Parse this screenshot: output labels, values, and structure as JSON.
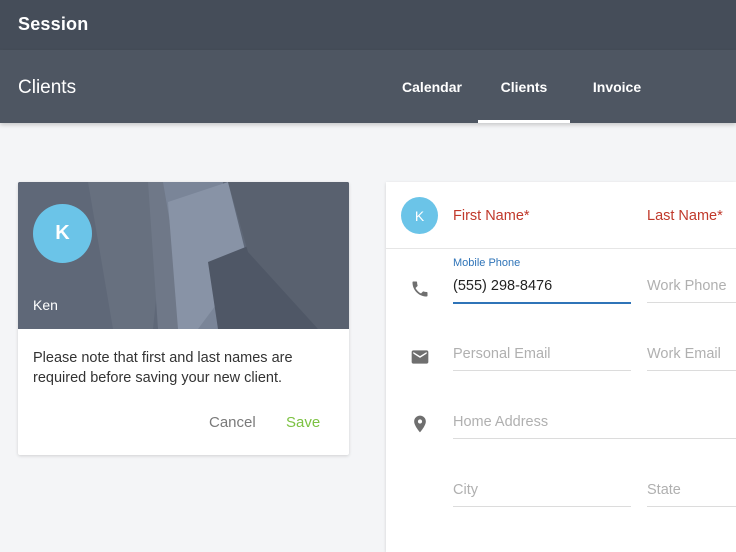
{
  "app": {
    "title": "Session"
  },
  "header": {
    "title": "Clients",
    "tabs": [
      {
        "label": "Calendar"
      },
      {
        "label": "Clients",
        "active": true
      },
      {
        "label": "Invoice"
      }
    ]
  },
  "client_card": {
    "initial": "K",
    "name": "Ken",
    "note": "Please note that first and last names are required before saving your new client.",
    "cancel_label": "Cancel",
    "save_label": "Save"
  },
  "form": {
    "initial": "K",
    "first_name_label": "First Name*",
    "last_name_label": "Last Name*",
    "mobile_phone_label": "Mobile Phone",
    "mobile_phone_value": "(555) 298-8476",
    "work_phone_placeholder": "Work Phone",
    "personal_email_placeholder": "Personal Email",
    "work_email_placeholder": "Work Email",
    "home_address_placeholder": "Home Address",
    "city_placeholder": "City",
    "state_placeholder": "State"
  },
  "colors": {
    "topbar": "#454d59",
    "subbar": "#4e5662",
    "avatar": "#6bc4e8",
    "required": "#c0392b",
    "focus": "#2f74b8",
    "save": "#7cc242"
  },
  "icons": [
    "phone-icon",
    "email-icon",
    "location-pin-icon"
  ]
}
